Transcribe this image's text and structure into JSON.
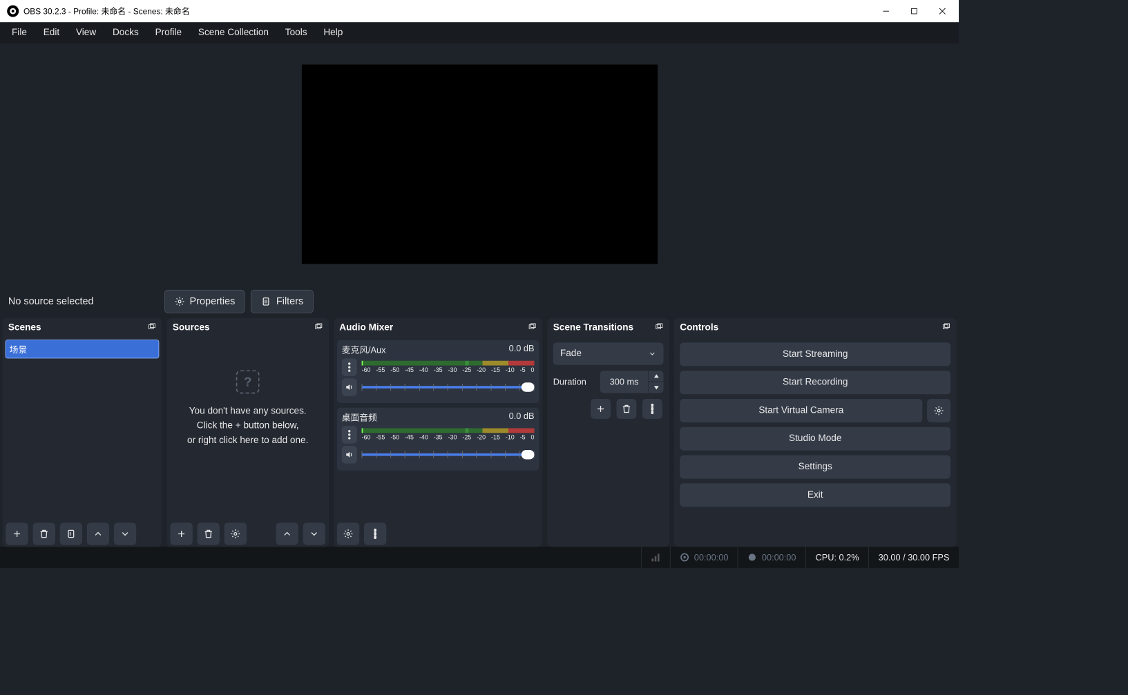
{
  "window": {
    "title": "OBS 30.2.3 - Profile: 未命名 - Scenes: 未命名"
  },
  "menu": [
    "File",
    "Edit",
    "View",
    "Docks",
    "Profile",
    "Scene Collection",
    "Tools",
    "Help"
  ],
  "sourceInfo": {
    "selected": "No source selected",
    "properties": "Properties",
    "filters": "Filters"
  },
  "docks": {
    "scenes": {
      "title": "Scenes",
      "items": [
        "场景"
      ],
      "editing_value": "场景"
    },
    "sources": {
      "title": "Sources",
      "empty_line1": "You don't have any sources.",
      "empty_line2": "Click the + button below,",
      "empty_line3": "or right click here to add one."
    },
    "mixer": {
      "title": "Audio Mixer",
      "ticks": [
        "-60",
        "-55",
        "-50",
        "-45",
        "-40",
        "-35",
        "-30",
        "-25",
        "-20",
        "-15",
        "-10",
        "-5",
        "0"
      ],
      "channels": [
        {
          "name": "麦克风/Aux",
          "level": "0.0 dB"
        },
        {
          "name": "桌面音频",
          "level": "0.0 dB"
        }
      ]
    },
    "transitions": {
      "title": "Scene Transitions",
      "current": "Fade",
      "duration_label": "Duration",
      "duration_value": "300 ms"
    },
    "controls": {
      "title": "Controls",
      "buttons": {
        "stream": "Start Streaming",
        "record": "Start Recording",
        "vcam": "Start Virtual Camera",
        "studio": "Studio Mode",
        "settings": "Settings",
        "exit": "Exit"
      }
    }
  },
  "status": {
    "time1": "00:00:00",
    "time2": "00:00:00",
    "cpu": "CPU: 0.2%",
    "fps": "30.00 / 30.00 FPS"
  }
}
